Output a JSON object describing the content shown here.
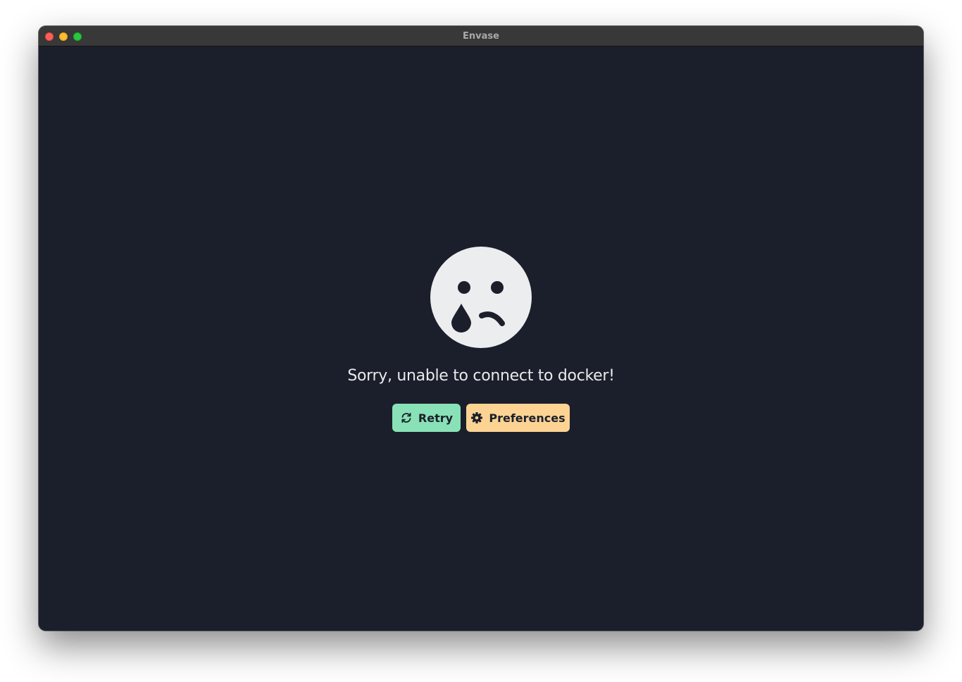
{
  "window": {
    "title": "Envase"
  },
  "error": {
    "icon": "sad-tear-face-icon",
    "message": "Sorry, unable to connect to docker!"
  },
  "actions": {
    "retry": {
      "label": "Retry",
      "icon": "refresh-icon"
    },
    "preferences": {
      "label": "Preferences",
      "icon": "gear-icon"
    }
  },
  "colors": {
    "background": "#1b1f2b",
    "titlebar": "#383838",
    "face": "#ebedef",
    "retry_button": "#89e2b7",
    "preferences_button": "#fdd393"
  }
}
